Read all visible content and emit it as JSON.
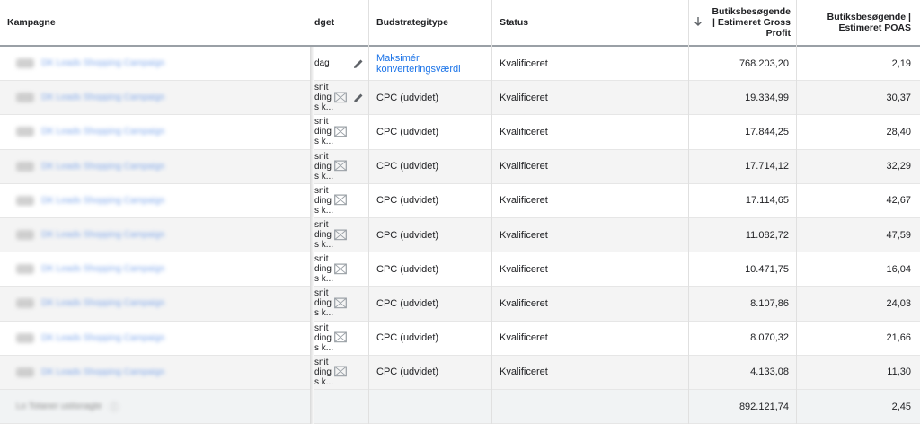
{
  "header": {
    "campaign": "Kampagne",
    "budget": "dget",
    "strategy": "Budstrategitype",
    "status": "Status",
    "gross_profit_l1": "Butiksbesøgende",
    "gross_profit_l2": "| Estimeret Gross",
    "gross_profit_l3": "Profit",
    "poas_l1": "Butiksbesøgende |",
    "poas_l2": "Estimeret POAS"
  },
  "rows": [
    {
      "budget_l1": "dag",
      "budget_l2": "",
      "budget_l3": "",
      "strategy_l1": "Maksimér",
      "strategy_l2": "konverteringsværdi",
      "status": "Kvalificeret",
      "gross_profit": "768.203,20",
      "poas": "2,19"
    },
    {
      "budget_l1": "snit",
      "budget_l2": "ding",
      "budget_l3": "s k...",
      "strategy_l1": "CPC (udvidet)",
      "strategy_l2": "",
      "status": "Kvalificeret",
      "gross_profit": "19.334,99",
      "poas": "30,37"
    },
    {
      "budget_l1": "snit",
      "budget_l2": "ding",
      "budget_l3": "s k...",
      "strategy_l1": "CPC (udvidet)",
      "strategy_l2": "",
      "status": "Kvalificeret",
      "gross_profit": "17.844,25",
      "poas": "28,40"
    },
    {
      "budget_l1": "snit",
      "budget_l2": "ding",
      "budget_l3": "s k...",
      "strategy_l1": "CPC (udvidet)",
      "strategy_l2": "",
      "status": "Kvalificeret",
      "gross_profit": "17.714,12",
      "poas": "32,29"
    },
    {
      "budget_l1": "snit",
      "budget_l2": "ding",
      "budget_l3": "s k...",
      "strategy_l1": "CPC (udvidet)",
      "strategy_l2": "",
      "status": "Kvalificeret",
      "gross_profit": "17.114,65",
      "poas": "42,67"
    },
    {
      "budget_l1": "snit",
      "budget_l2": "ding",
      "budget_l3": "s k...",
      "strategy_l1": "CPC (udvidet)",
      "strategy_l2": "",
      "status": "Kvalificeret",
      "gross_profit": "11.082,72",
      "poas": "47,59"
    },
    {
      "budget_l1": "snit",
      "budget_l2": "ding",
      "budget_l3": "s k...",
      "strategy_l1": "CPC (udvidet)",
      "strategy_l2": "",
      "status": "Kvalificeret",
      "gross_profit": "10.471,75",
      "poas": "16,04"
    },
    {
      "budget_l1": "snit",
      "budget_l2": "ding",
      "budget_l3": "s k...",
      "strategy_l1": "CPC (udvidet)",
      "strategy_l2": "",
      "status": "Kvalificeret",
      "gross_profit": "8.107,86",
      "poas": "24,03"
    },
    {
      "budget_l1": "snit",
      "budget_l2": "ding",
      "budget_l3": "s k...",
      "strategy_l1": "CPC (udvidet)",
      "strategy_l2": "",
      "status": "Kvalificeret",
      "gross_profit": "8.070,32",
      "poas": "21,66"
    },
    {
      "budget_l1": "snit",
      "budget_l2": "ding",
      "budget_l3": "s k...",
      "strategy_l1": "CPC (udvidet)",
      "strategy_l2": "",
      "status": "Kvalificeret",
      "gross_profit": "4.133,08",
      "poas": "11,30"
    }
  ],
  "total": {
    "gross_profit": "892.121,74",
    "poas": "2,45"
  },
  "colors": {
    "link": "#1a73e8",
    "header_border": "#9aa0a6",
    "alt_row": "#f4f4f4"
  },
  "icons": {
    "edit": "pencil-icon",
    "image": "image-icon",
    "sort": "arrow-down-icon"
  }
}
